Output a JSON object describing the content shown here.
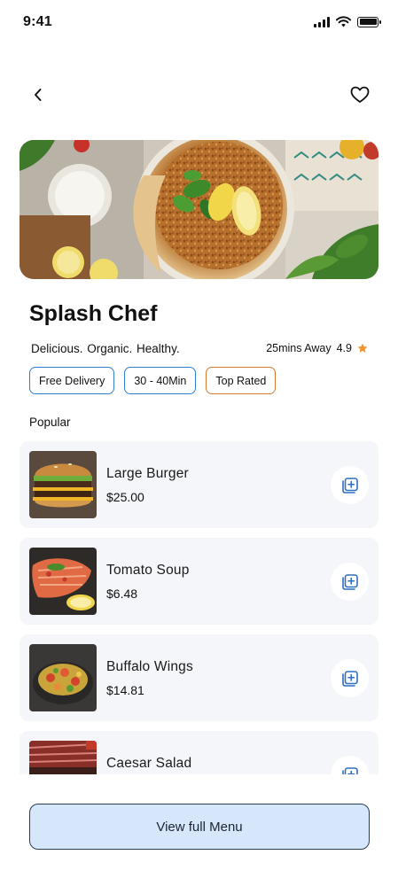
{
  "status_bar": {
    "time": "9:41"
  },
  "icons": {
    "back": "chevron-left-icon",
    "favorite": "heart-icon",
    "rating_star": "star-icon",
    "add_to_cart": "add-square-icon"
  },
  "colors": {
    "accent_blue": "#2f7fd0",
    "accent_orange": "#d9782f",
    "star": "#f0952d",
    "card_bg": "#f5f6fa",
    "button_bg": "#d6e6fb"
  },
  "restaurant": {
    "name": "Splash Chef",
    "tagline": "Delicious. Organic. Healthy.",
    "distance": "25mins Away",
    "rating": "4.9"
  },
  "tags": [
    {
      "label": "Free Delivery"
    },
    {
      "label": "30 - 40Min"
    },
    {
      "label": "Top Rated"
    }
  ],
  "popular": {
    "title": "Popular",
    "items": [
      {
        "name": "Large Burger",
        "price": "$25.00"
      },
      {
        "name": "Tomato Soup",
        "price": "$6.48"
      },
      {
        "name": "Buffalo Wings",
        "price": "$14.81"
      },
      {
        "name": "Caesar Salad",
        "price": ""
      }
    ]
  },
  "footer": {
    "view_menu_label": "View full Menu"
  }
}
